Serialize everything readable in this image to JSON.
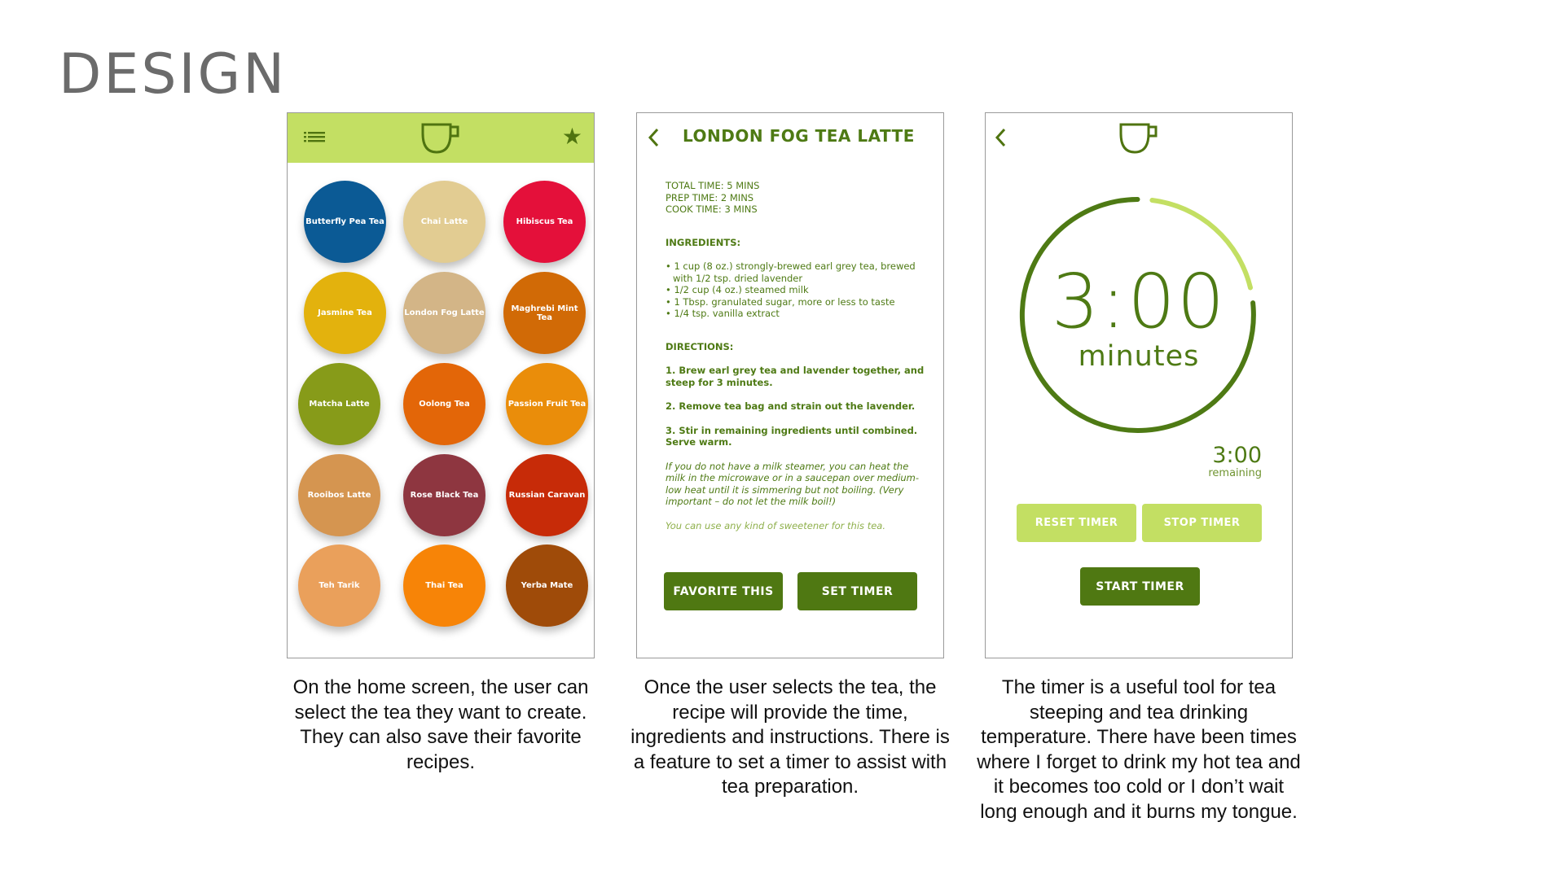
{
  "slide": {
    "title": "DESIGN"
  },
  "colors": {
    "accent_light": "#c3df63",
    "accent_dark": "#4f7812",
    "text_green": "#4e7a14"
  },
  "home": {
    "icons": {
      "menu": "list-menu-icon",
      "logo": "tea-cup-icon",
      "favorites": "star-icon"
    },
    "teas": [
      {
        "name": "Butterfly Pea Tea",
        "color": "#0b5a95"
      },
      {
        "name": "Chai Latte",
        "color": "#e2cc92"
      },
      {
        "name": "Hibiscus Tea",
        "color": "#e4103a"
      },
      {
        "name": "Jasmine Tea",
        "color": "#e3b20d"
      },
      {
        "name": "London Fog Latte",
        "color": "#d3b587"
      },
      {
        "name": "Maghrebi Mint Tea",
        "color": "#d16a06"
      },
      {
        "name": "Matcha Latte",
        "color": "#879b19"
      },
      {
        "name": "Oolong Tea",
        "color": "#e36608"
      },
      {
        "name": "Passion Fruit Tea",
        "color": "#ea8d0a"
      },
      {
        "name": "Rooibos Latte",
        "color": "#d59550"
      },
      {
        "name": "Rose Black Tea",
        "color": "#8e3640"
      },
      {
        "name": "Russian Caravan",
        "color": "#c72b08"
      },
      {
        "name": "Teh Tarik",
        "color": "#eaa05b"
      },
      {
        "name": "Thai Tea",
        "color": "#f78407"
      },
      {
        "name": "Yerba Mate",
        "color": "#9f4b09"
      }
    ]
  },
  "recipe": {
    "title": "LONDON FOG TEA LATTE",
    "times": [
      "TOTAL TIME: 5 MINS",
      "PREP TIME: 2 MINS",
      "COOK TIME: 3 MINS"
    ],
    "ingredients_heading": "INGREDIENTS:",
    "ingredients": [
      "• 1 cup (8 oz.) strongly-brewed earl grey tea, brewed with 1/2 tsp. dried lavender",
      "• 1/2 cup (4 oz.) steamed milk",
      "• 1 Tbsp. granulated sugar, more or less to taste",
      "• 1/4 tsp. vanilla extract"
    ],
    "directions_heading": "DIRECTIONS:",
    "directions": [
      "1. Brew earl grey tea and lavender together, and steep for 3 minutes.",
      "2. Remove tea bag and strain out the lavender.",
      "3. Stir in remaining ingredients until combined. Serve warm."
    ],
    "note": "If you do not have a milk steamer, you can heat the milk in the microwave or in a saucepan over medium-low heat until it is simmering but not boiling. (Very important – do not let the milk boil!)",
    "note2": "You can use any kind of sweetener for this tea.",
    "favorite_label": "FAVORITE THIS",
    "set_timer_label": "SET TIMER"
  },
  "timer": {
    "display": "3:00",
    "unit": "minutes",
    "remaining_time": "3:00",
    "remaining_label": "remaining",
    "progress_fraction": 1.0,
    "reset_label": "RESET TIMER",
    "stop_label": "STOP TIMER",
    "start_label": "START TIMER"
  },
  "captions": {
    "home": "On the home screen, the user can select the tea they want to create. They can also save their favorite recipes.",
    "recipe": "Once the user selects the tea, the recipe will provide the time, ingredients and instructions. There is a feature to set a timer to assist with tea preparation.",
    "timer": "The timer is a useful tool for tea steeping and tea drinking temperature. There have been times where I forget to drink my hot tea and it becomes too cold or I don’t wait long enough and it burns my tongue."
  }
}
